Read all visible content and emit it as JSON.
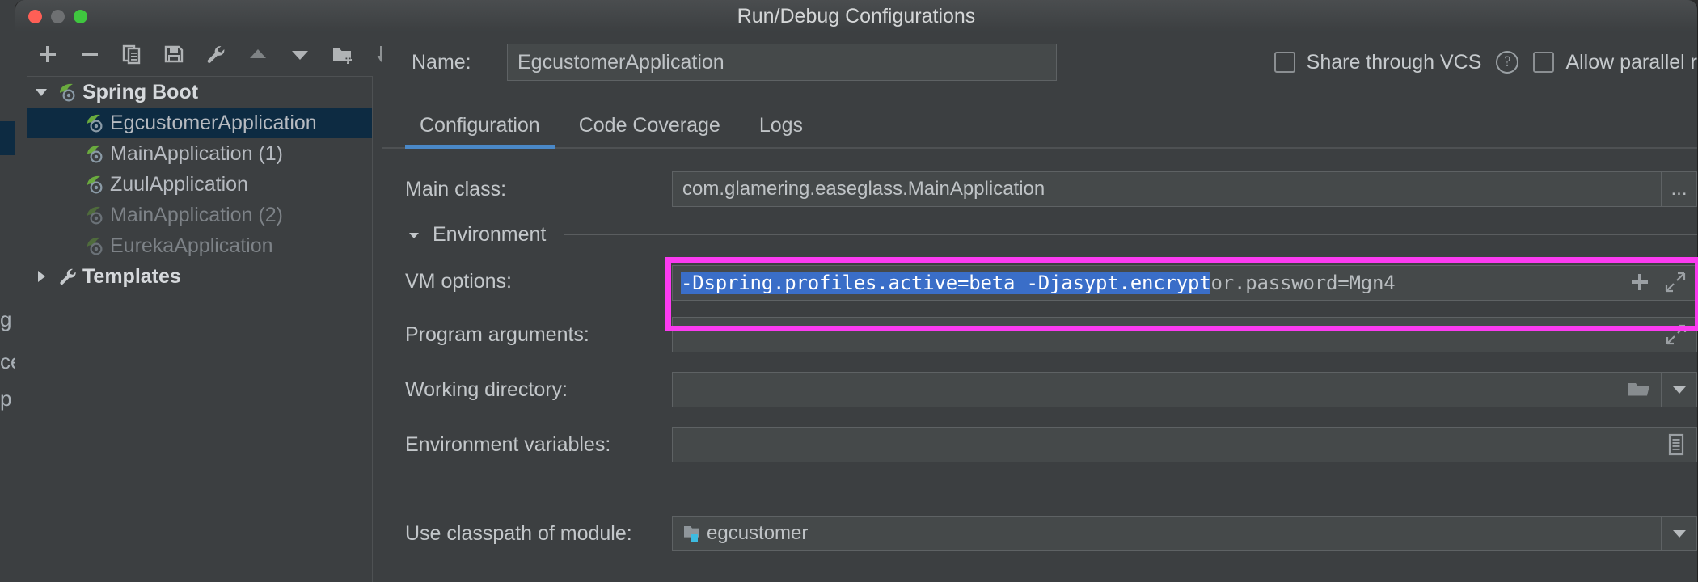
{
  "window": {
    "title": "Run/Debug Configurations",
    "traffic_lights": [
      "close-red",
      "minimize-gray",
      "maximize-green"
    ]
  },
  "behind_window": {
    "fragments": [
      "g",
      "ce",
      "p"
    ]
  },
  "left_panel": {
    "toolbar": [
      {
        "name": "add-configuration-button",
        "icon": "plus-icon"
      },
      {
        "name": "remove-configuration-button",
        "icon": "minus-icon"
      },
      {
        "name": "copy-configuration-button",
        "icon": "copy-icon"
      },
      {
        "name": "save-configuration-button",
        "icon": "save-icon"
      },
      {
        "name": "edit-templates-button",
        "icon": "wrench-icon"
      },
      {
        "name": "move-up-button",
        "icon": "arrow-up-icon"
      },
      {
        "name": "move-down-button",
        "icon": "arrow-down-icon"
      },
      {
        "name": "new-folder-button",
        "icon": "new-folder-icon"
      },
      {
        "name": "sort-alphabetically-button",
        "icon": "sort-az-icon"
      }
    ],
    "tree": [
      {
        "label": "Spring Boot",
        "type": "group",
        "expanded": true,
        "icon": "spring-boot-icon",
        "selected": false,
        "dim": false
      },
      {
        "label": "EgcustomerApplication",
        "type": "item",
        "icon": "spring-boot-icon",
        "selected": true,
        "dim": false
      },
      {
        "label": "MainApplication (1)",
        "type": "item",
        "icon": "spring-boot-icon",
        "selected": false,
        "dim": false
      },
      {
        "label": "ZuulApplication",
        "type": "item",
        "icon": "spring-boot-icon",
        "selected": false,
        "dim": false
      },
      {
        "label": "MainApplication (2)",
        "type": "item",
        "icon": "spring-boot-icon",
        "selected": false,
        "dim": true
      },
      {
        "label": "EurekaApplication",
        "type": "item",
        "icon": "spring-boot-icon",
        "selected": false,
        "dim": true
      },
      {
        "label": "Templates",
        "type": "group",
        "expanded": false,
        "icon": "wrench-icon",
        "selected": false,
        "dim": false
      }
    ]
  },
  "right_panel": {
    "name_label": "Name:",
    "name_value": "EgcustomerApplication",
    "share_vcs_label": "Share through VCS",
    "share_vcs_checked": false,
    "help_glyph": "?",
    "allow_parallel_label": "Allow parallel r",
    "allow_parallel_checked": false,
    "tabs": [
      {
        "label": "Configuration",
        "active": true
      },
      {
        "label": "Code Coverage",
        "active": false
      },
      {
        "label": "Logs",
        "active": false
      }
    ],
    "main_class_label": "Main class:",
    "main_class_value": "com.glamering.easeglass.MainApplication",
    "main_class_browse_label": "...",
    "environment_section_label": "Environment",
    "vm_options_label": "VM options:",
    "vm_options_selected_text": "-Dspring.profiles.active=beta -Djasypt.encrypt",
    "vm_options_trailing_text": "or.password=Mgn4",
    "vm_options_macro_icon": "plus-icon",
    "vm_options_expand_icon": "expand-icon",
    "program_arguments_label": "Program arguments:",
    "program_arguments_value": "",
    "program_arguments_expand_icon": "expand-icon",
    "working_directory_label": "Working directory:",
    "working_directory_value": "",
    "working_directory_browse_icon": "folder-icon",
    "working_directory_dropdown_icon": "chevron-down-icon",
    "environment_variables_label": "Environment variables:",
    "environment_variables_value": "",
    "environment_variables_icon": "list-icon",
    "use_classpath_label": "Use classpath of module:",
    "use_classpath_value": "egcustomer",
    "use_classpath_module_icon": "module-icon",
    "use_classpath_dropdown_icon": "chevron-down-icon"
  },
  "colors": {
    "window_bg": "#3c3f41",
    "titlebar_top": "#4a4d4f",
    "tree_selection": "#0d2b42",
    "text_selection": "#3a6ec8",
    "tab_underline": "#4a88c7",
    "annotation_box": "#fb3bf0",
    "spring_green": "#6aaa3e"
  }
}
